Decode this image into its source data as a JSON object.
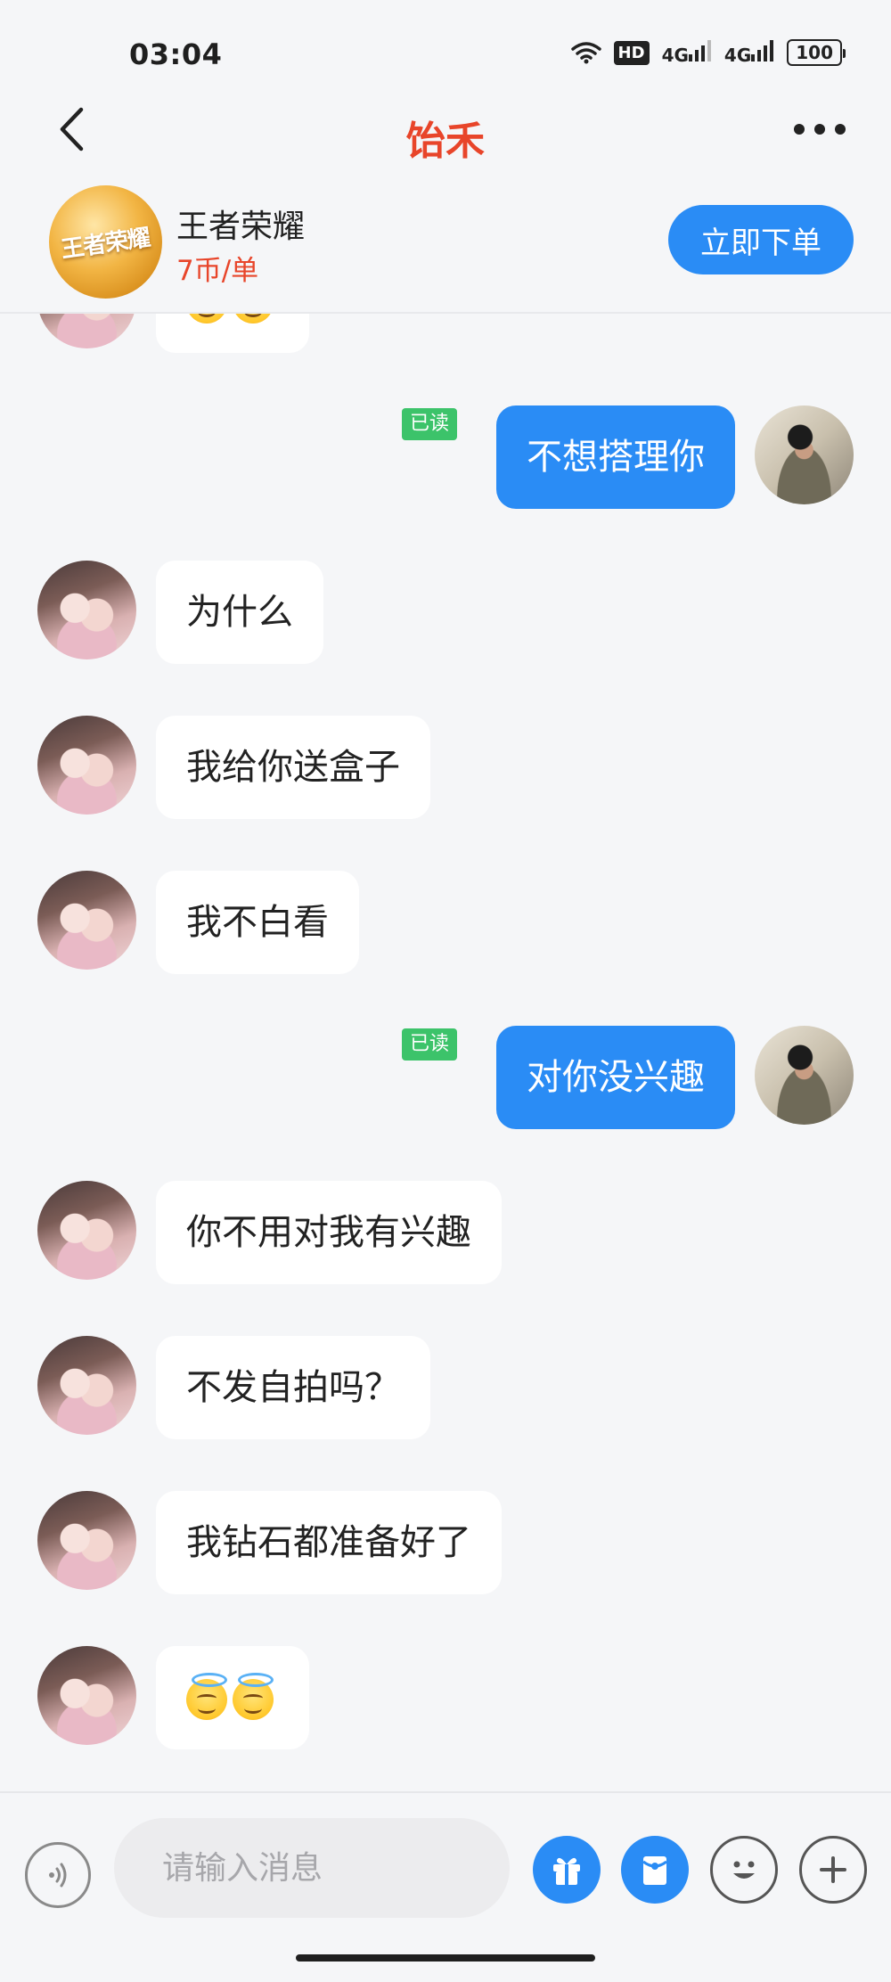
{
  "status_bar": {
    "time": "03:04",
    "network": "4G",
    "hd": "HD",
    "battery": "100"
  },
  "nav": {
    "title": "饴禾"
  },
  "service": {
    "game_name": "王者荣耀",
    "price": "7币/单",
    "order_button": "立即下单",
    "logo_text": "王者荣耀"
  },
  "messages": [
    {
      "from": "them",
      "text": "😇😇"
    },
    {
      "from": "me",
      "text": "不想搭理你",
      "read_label": "已读"
    },
    {
      "from": "them",
      "text": "为什么"
    },
    {
      "from": "them",
      "text": "我给你送盒子"
    },
    {
      "from": "them",
      "text": "我不白看"
    },
    {
      "from": "me",
      "text": "对你没兴趣",
      "read_label": "已读"
    },
    {
      "from": "them",
      "text": "你不用对我有兴趣"
    },
    {
      "from": "them",
      "text": "不发自拍吗？"
    },
    {
      "from": "them",
      "text": "我钻石都准备好了"
    },
    {
      "from": "them",
      "text": "😇😇"
    }
  ],
  "input": {
    "placeholder": "请输入消息"
  },
  "icons": {
    "back": "chevron-left-icon",
    "more": "more-horizontal-icon",
    "voice": "voice-icon",
    "gift": "gift-icon",
    "red_packet": "red-packet-icon",
    "emoji": "smiley-icon",
    "plus": "plus-icon"
  },
  "colors": {
    "accent_blue": "#2a8cf5",
    "title_red": "#e8452a",
    "read_green": "#3cc36a",
    "background": "#f5f6f8"
  }
}
